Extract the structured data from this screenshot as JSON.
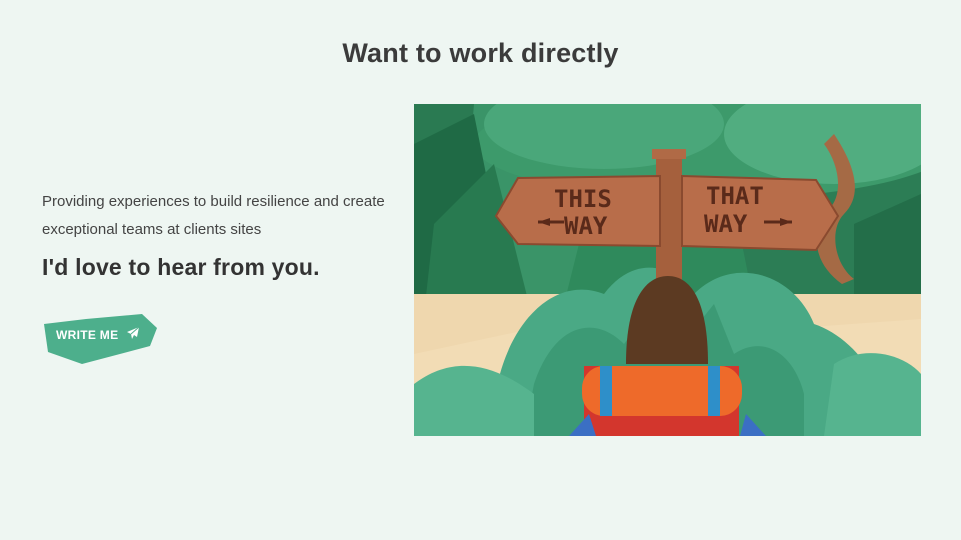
{
  "page": {
    "title": "Want to work directly"
  },
  "intro": {
    "description": "Providing experiences to build resilience and create exceptional teams at clients sites",
    "cta": "I'd love to hear from you."
  },
  "button": {
    "label": "WRITE ME",
    "icon": "paper-plane-icon",
    "color": "#4daf8c"
  },
  "illustration": {
    "sign_left": [
      "THIS",
      "WAY"
    ],
    "sign_right": [
      "THAT",
      "WAY"
    ]
  }
}
